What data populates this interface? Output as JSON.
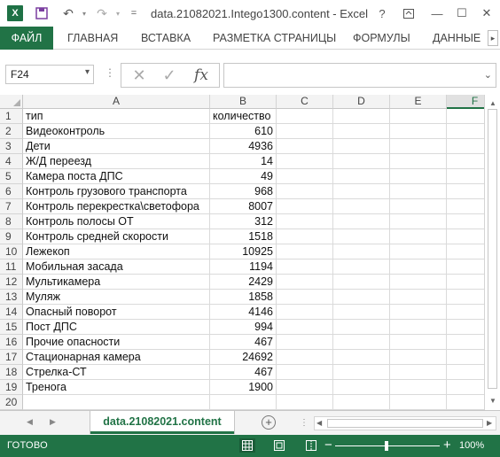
{
  "window": {
    "title": "data.21082021.Intego1300.content - Excel",
    "help": "?",
    "restore": "⧉",
    "minimize": "—",
    "maximize": "☐",
    "close": "✕"
  },
  "quick_access": {
    "app_logo": "X",
    "save_icon": "save-icon",
    "undo_icon": "undo-icon",
    "redo_icon": "redo-icon",
    "customize": "="
  },
  "ribbon": {
    "tabs": [
      {
        "label": "ФАЙЛ"
      },
      {
        "label": "ГЛАВНАЯ"
      },
      {
        "label": "ВСТАВКА"
      },
      {
        "label": "РАЗМЕТКА СТРАНИЦЫ"
      },
      {
        "label": "ФОРМУЛЫ"
      },
      {
        "label": "ДАННЫЕ"
      }
    ],
    "more": "▸"
  },
  "formula_bar": {
    "name_box": "F24",
    "cancel": "✕",
    "enter": "✓",
    "fx": "fx",
    "value": ""
  },
  "columns": [
    "A",
    "B",
    "C",
    "D",
    "E",
    "F"
  ],
  "rows": [
    {
      "n": "1",
      "a": "тип",
      "b": "количество"
    },
    {
      "n": "2",
      "a": "Видеоконтроль",
      "b": "610"
    },
    {
      "n": "3",
      "a": "Дети",
      "b": "4936"
    },
    {
      "n": "4",
      "a": "Ж/Д переезд",
      "b": "14"
    },
    {
      "n": "5",
      "a": "Камера поста ДПС",
      "b": "49"
    },
    {
      "n": "6",
      "a": "Контроль грузового транспорта",
      "b": "968"
    },
    {
      "n": "7",
      "a": "Контроль перекрестка\\светофора",
      "b": "8007"
    },
    {
      "n": "8",
      "a": "Контроль полосы ОТ",
      "b": "312"
    },
    {
      "n": "9",
      "a": "Контроль средней скорости",
      "b": "1518"
    },
    {
      "n": "10",
      "a": "Лежекоп",
      "b": "10925"
    },
    {
      "n": "11",
      "a": "Мобильная засада",
      "b": "1194"
    },
    {
      "n": "12",
      "a": "Мультикамера",
      "b": "2429"
    },
    {
      "n": "13",
      "a": "Муляж",
      "b": "1858"
    },
    {
      "n": "14",
      "a": "Опасный поворот",
      "b": "4146"
    },
    {
      "n": "15",
      "a": "Пост ДПС",
      "b": "994"
    },
    {
      "n": "16",
      "a": "Прочие опасности",
      "b": "467"
    },
    {
      "n": "17",
      "a": "Стационарная камера",
      "b": "24692"
    },
    {
      "n": "18",
      "a": "Стрелка-СТ",
      "b": "467"
    },
    {
      "n": "19",
      "a": "Тренога",
      "b": "1900"
    },
    {
      "n": "20",
      "a": "",
      "b": ""
    }
  ],
  "sheets": {
    "active": "data.21082021.content",
    "add": "+"
  },
  "status": {
    "ready": "ГОТОВО",
    "zoom": "100%",
    "zoom_minus": "−",
    "zoom_plus": "+"
  },
  "colors": {
    "accent": "#217346",
    "grid": "#dadada"
  }
}
